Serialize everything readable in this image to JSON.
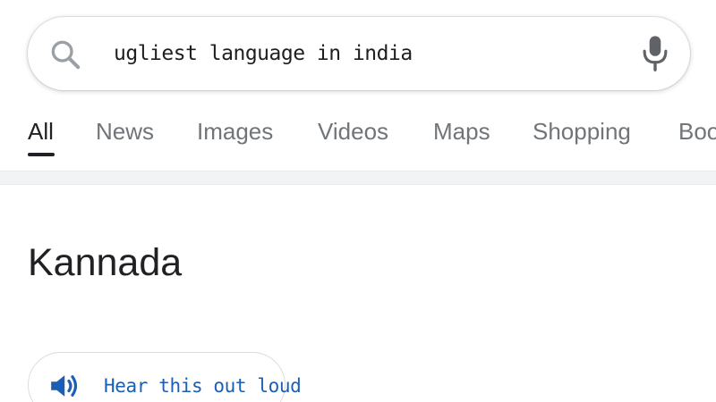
{
  "search": {
    "query": "ugliest language in india",
    "left_icon": "search-icon",
    "right_icon": "mic-icon"
  },
  "tabs": [
    {
      "label": "All",
      "active": true
    },
    {
      "label": "News",
      "active": false
    },
    {
      "label": "Images",
      "active": false
    },
    {
      "label": "Videos",
      "active": false
    },
    {
      "label": "Maps",
      "active": false
    },
    {
      "label": "Shopping",
      "active": false
    },
    {
      "label": "Boo",
      "active": false
    }
  ],
  "answer": {
    "title": "Kannada",
    "hear_button_label": "Hear this out loud",
    "hear_button_icon": "speaker-icon"
  },
  "colors": {
    "link_blue": "#1a5fb4",
    "text_dark": "#202124",
    "text_muted": "#70757a",
    "divider": "#f1f3f4"
  }
}
